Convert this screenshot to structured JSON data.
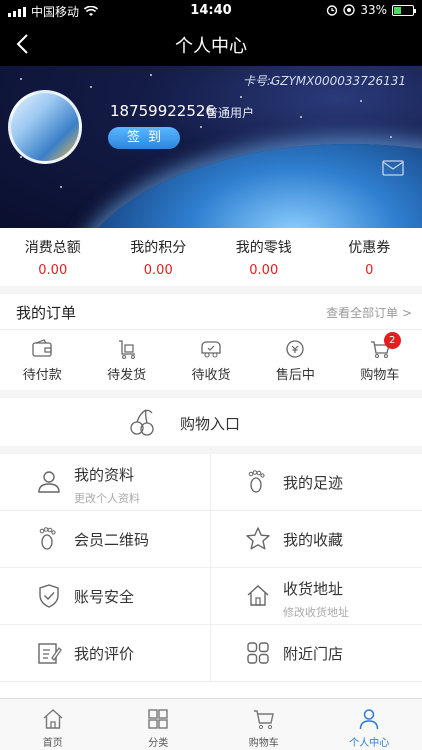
{
  "status_bar": {
    "carrier": "中国移动",
    "time": "14:40",
    "battery": "33%",
    "battery_level": 0.33
  },
  "nav": {
    "title": "个人中心"
  },
  "profile": {
    "card_number": "卡号:GZYMX000033726131",
    "phone": "18759922526",
    "level": "普通用户",
    "checkin_label": "签到"
  },
  "stats": [
    {
      "label": "消费总额",
      "value": "0.00"
    },
    {
      "label": "我的积分",
      "value": "0.00"
    },
    {
      "label": "我的零钱",
      "value": "0.00"
    },
    {
      "label": "优惠券",
      "value": "0"
    }
  ],
  "orders": {
    "title": "我的订单",
    "view_all": "查看全部订单 >",
    "items": [
      {
        "label": "待付款",
        "icon": "wallet-icon"
      },
      {
        "label": "待发货",
        "icon": "cart-package-icon"
      },
      {
        "label": "待收货",
        "icon": "delivery-truck-icon"
      },
      {
        "label": "售后中",
        "icon": "refund-icon"
      },
      {
        "label": "购物车",
        "icon": "shopping-cart-icon",
        "badge": "2"
      }
    ]
  },
  "shopping_entry": {
    "label": "购物入口",
    "icon": "cherries-icon"
  },
  "grid": [
    {
      "label": "我的资料",
      "sub": "更改个人资料",
      "icon": "user-icon"
    },
    {
      "label": "我的足迹",
      "sub": "",
      "icon": "footprint-icon"
    },
    {
      "label": "会员二维码",
      "sub": "",
      "icon": "footprint-icon"
    },
    {
      "label": "我的收藏",
      "sub": "",
      "icon": "star-icon"
    },
    {
      "label": "账号安全",
      "sub": "",
      "icon": "shield-icon"
    },
    {
      "label": "收货地址",
      "sub": "修改收货地址",
      "icon": "home-icon"
    },
    {
      "label": "我的评价",
      "sub": "",
      "icon": "edit-icon"
    },
    {
      "label": "附近门店",
      "sub": "",
      "icon": "store-grid-icon"
    }
  ],
  "tabbar": [
    {
      "label": "首页",
      "icon": "home-icon"
    },
    {
      "label": "分类",
      "icon": "grid-icon"
    },
    {
      "label": "购物车",
      "icon": "cart-icon"
    },
    {
      "label": "个人中心",
      "icon": "person-icon",
      "active": true
    }
  ],
  "colors": {
    "accent": "#2b7bd6",
    "value_red": "#e02020",
    "badge_red": "#e02020"
  }
}
